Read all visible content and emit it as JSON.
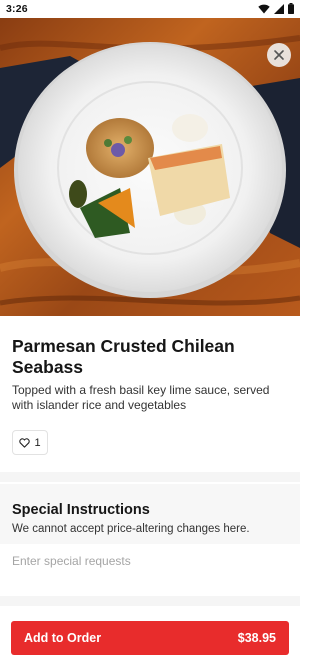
{
  "status_bar": {
    "time": "3:26",
    "icons": [
      "wifi-icon",
      "signal-icon",
      "battery-icon"
    ]
  },
  "hero": {
    "image": "plated-seabass-photo",
    "close_icon": "close-icon"
  },
  "dish": {
    "title": "Parmesan Crusted Chilean Seabass",
    "description": "Topped with a fresh basil key lime sauce, served with islander rice and vegetables",
    "likes": "1",
    "like_icon": "heart-outline-icon"
  },
  "special_instructions": {
    "title": "Special Instructions",
    "note": "We cannot accept price-altering changes here.",
    "placeholder": "Enter special requests",
    "value": ""
  },
  "order": {
    "label": "Add to Order",
    "price": "$38.95",
    "color": "#e82c2c"
  }
}
